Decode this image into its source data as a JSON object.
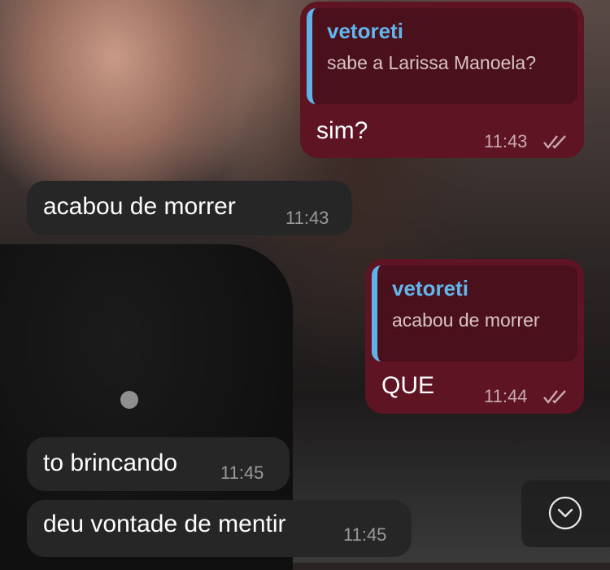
{
  "messages": [
    {
      "direction": "outgoing",
      "reply": {
        "name": "vetoreti",
        "text": "sabe a Larissa Manoela?"
      },
      "text": "sim?",
      "time": "11:43",
      "status": "read"
    },
    {
      "direction": "incoming",
      "text": "acabou de morrer",
      "time": "11:43"
    },
    {
      "direction": "outgoing",
      "reply": {
        "name": "vetoreti",
        "text": "acabou de morrer"
      },
      "text": "QUE",
      "time": "11:44",
      "status": "read"
    },
    {
      "direction": "incoming",
      "text": "to brincando",
      "time": "11:45"
    },
    {
      "direction": "incoming",
      "text": "deu vontade de mentir",
      "time": "11:45"
    }
  ],
  "colors": {
    "outgoing_bubble": "#5e1423",
    "incoming_bubble": "#262626",
    "reply_accent": "#5fb3e8"
  },
  "icons": {
    "read_status": "double-check-icon",
    "scroll_down": "chevron-down-circle-icon"
  }
}
